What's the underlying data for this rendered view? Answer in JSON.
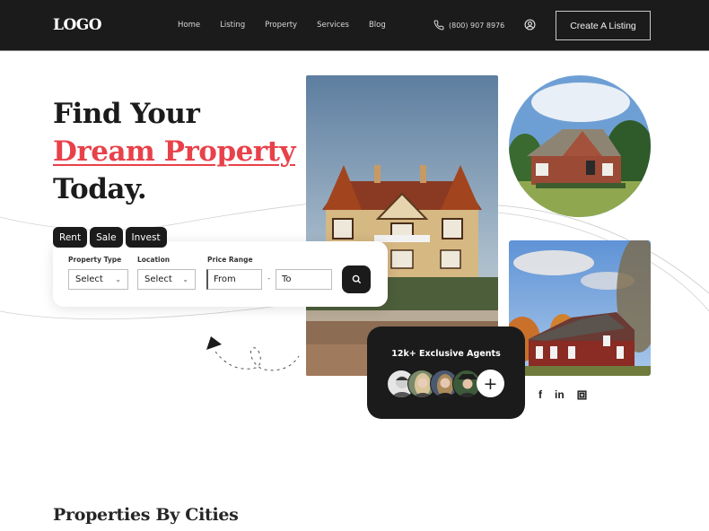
{
  "nav": {
    "logo": "LOGO",
    "links": [
      "Home",
      "Listing",
      "Property",
      "Services",
      "Blog"
    ],
    "phone": "(800) 907 8976",
    "phone_icon": "phone-icon",
    "user_icon": "user-circle-icon",
    "cta": "Create A Listing"
  },
  "hero": {
    "title_line1": "Find Your",
    "title_accent": "Dream Property",
    "title_line3": "Today.",
    "accent_color": "#e8414a"
  },
  "search": {
    "tabs": [
      "Rent",
      "Sale",
      "Invest"
    ],
    "property_type_label": "Property Type",
    "property_type_value": "Select",
    "location_label": "Location",
    "location_value": "Select",
    "price_range_label": "Price Range",
    "price_from_placeholder": "From",
    "price_to_placeholder": "To",
    "range_separator": "-",
    "search_icon": "search-icon"
  },
  "images": {
    "main": "tudor-style-house-photo",
    "circle": "brick-suburban-house-photo",
    "secondary": "red-barn-house-photo"
  },
  "agents": {
    "title": "12k+ Exclusive Agents",
    "avatars": [
      "agent-avatar-1",
      "agent-avatar-2",
      "agent-avatar-3",
      "agent-avatar-4"
    ],
    "more_label": "+"
  },
  "social": {
    "facebook": "f",
    "linkedin": "in",
    "instagram": "instagram-icon"
  },
  "sections": {
    "cities_title": "Properties By Cities"
  }
}
